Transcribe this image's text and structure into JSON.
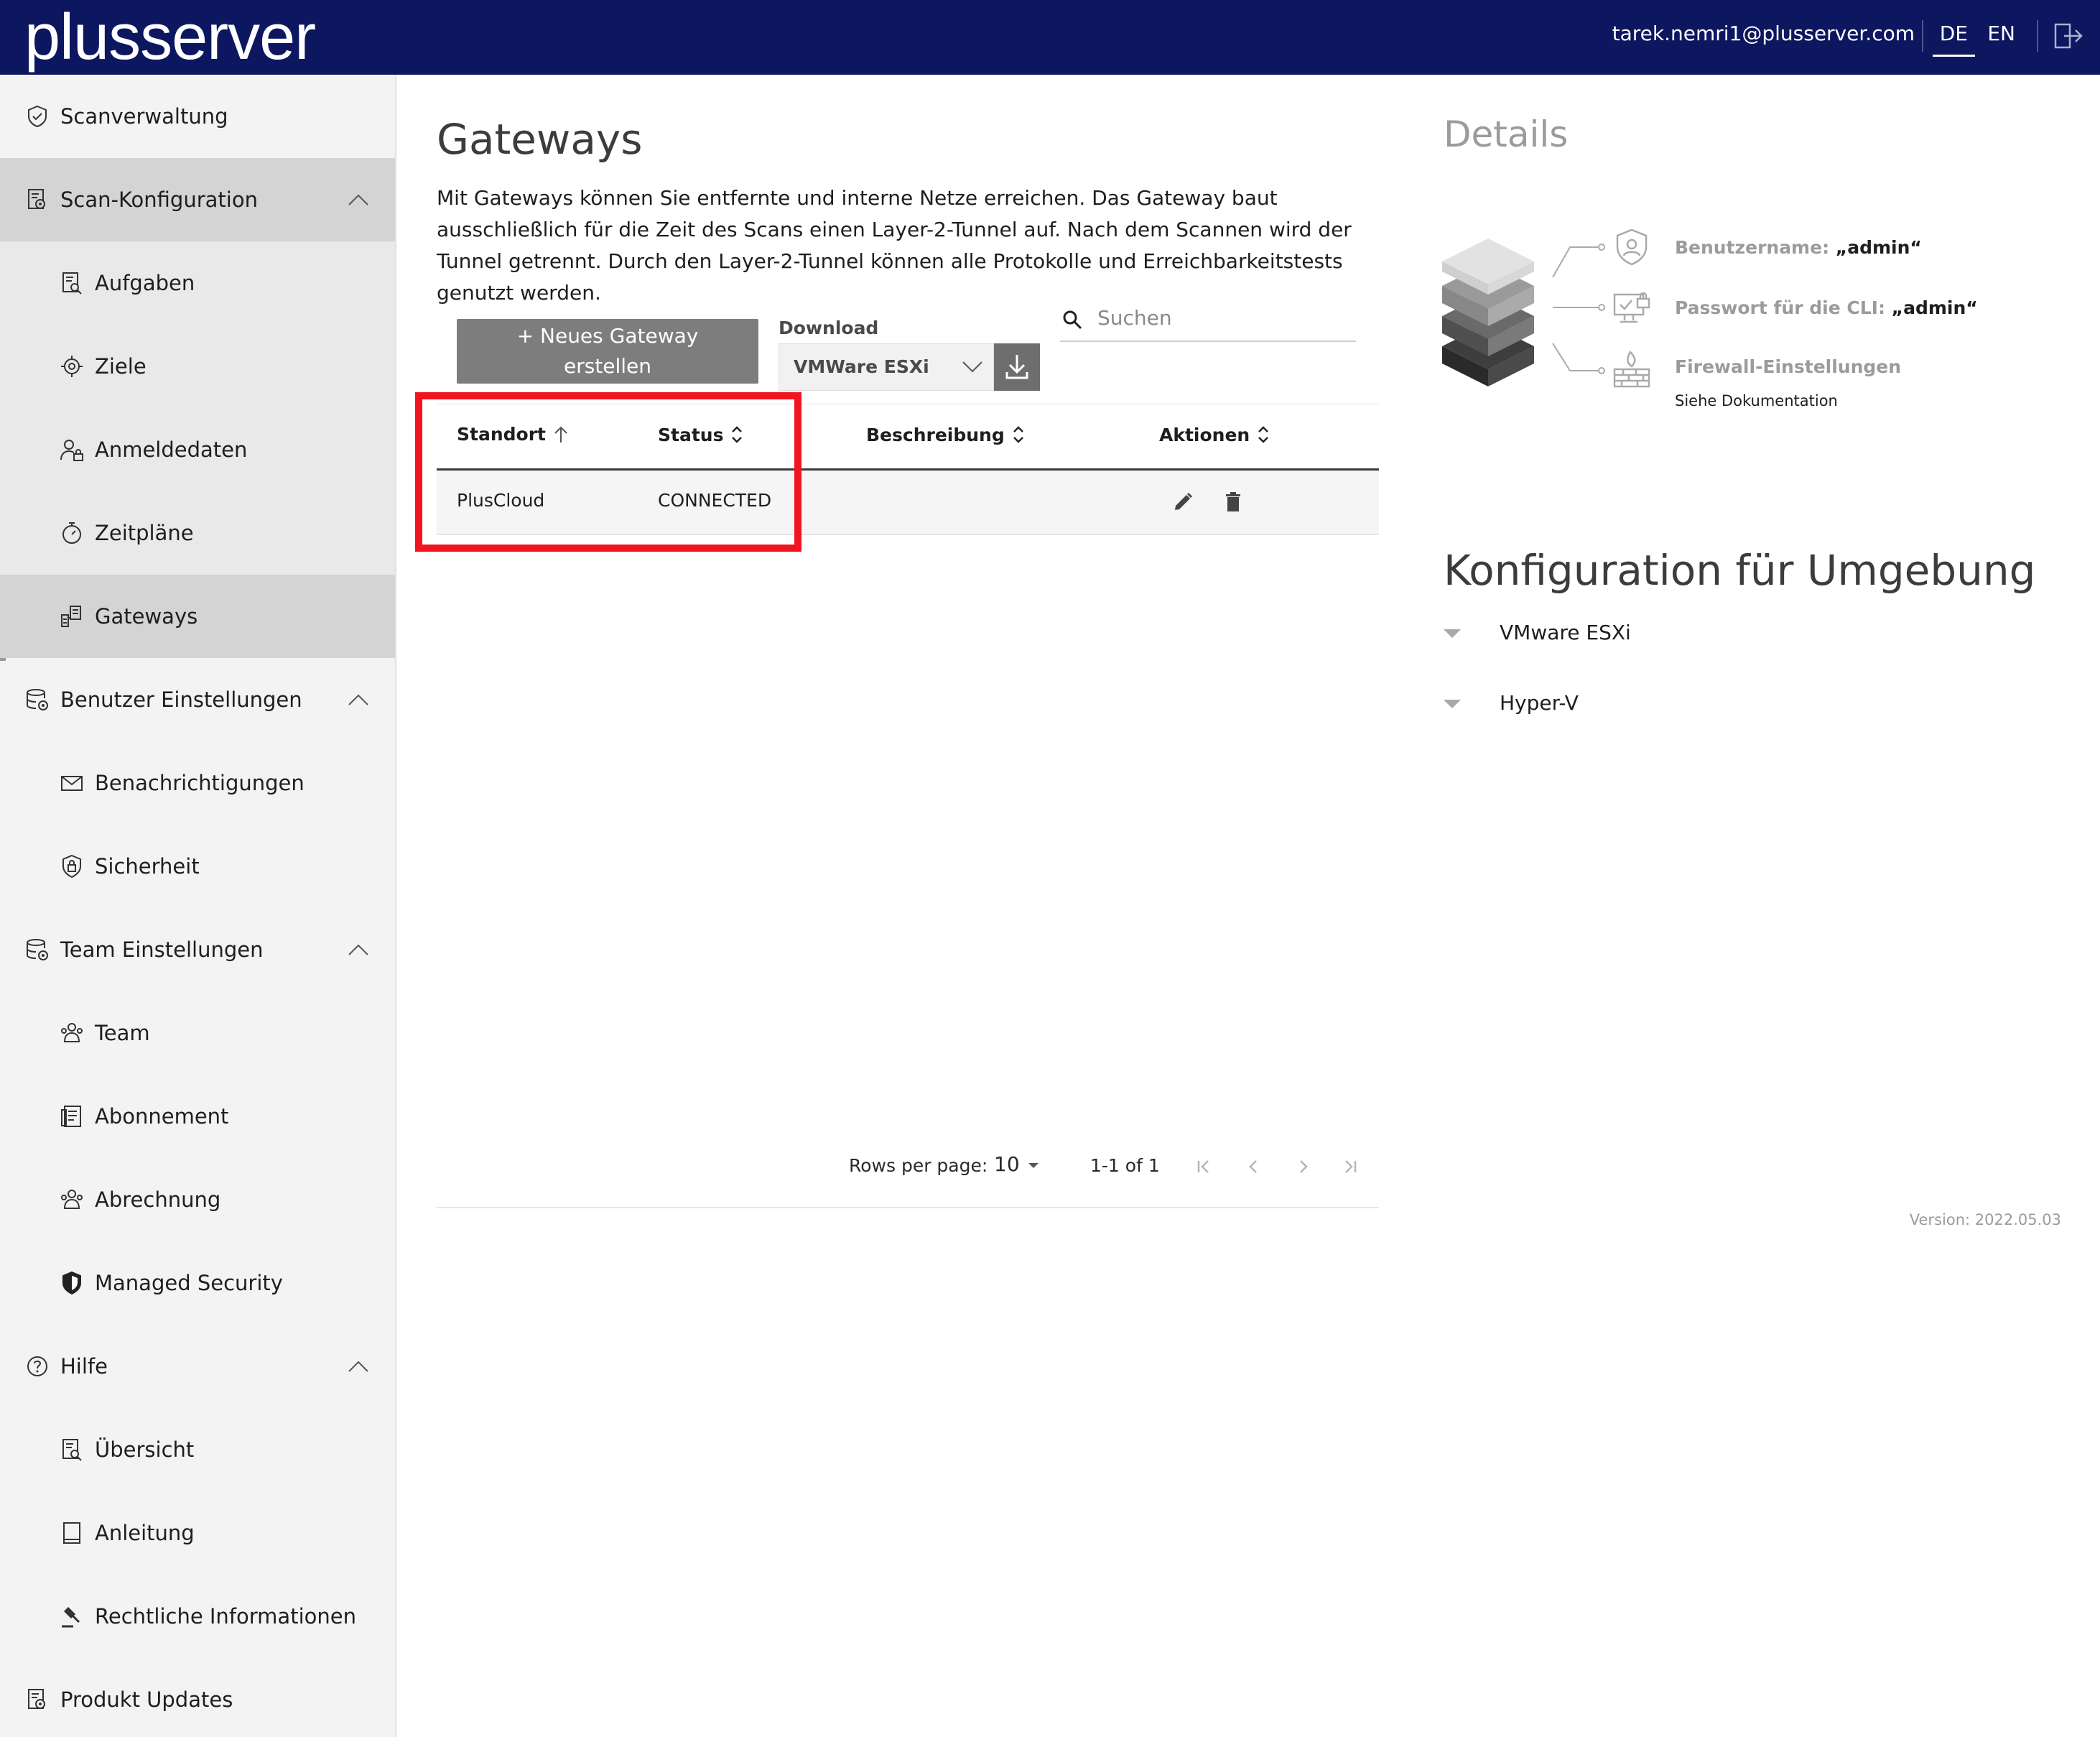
{
  "header": {
    "logo_text": "plusserver",
    "user_email": "tarek.nemri1@plusserver.com",
    "languages": [
      "DE",
      "EN"
    ],
    "active_language": "DE",
    "background_color": "#0d1760"
  },
  "sidebar": {
    "items": [
      {
        "label": "Scanverwaltung",
        "icon": "shield-check-icon",
        "level": "top"
      },
      {
        "label": "Scan-Konfiguration",
        "icon": "settings-document-icon",
        "level": "top",
        "expanded": true
      },
      {
        "label": "Aufgaben",
        "icon": "document-search-icon",
        "level": "sub"
      },
      {
        "label": "Ziele",
        "icon": "target-icon",
        "level": "sub"
      },
      {
        "label": "Anmeldedaten",
        "icon": "user-lock-icon",
        "level": "sub"
      },
      {
        "label": "Zeitpläne",
        "icon": "stopwatch-icon",
        "level": "sub"
      },
      {
        "label": "Gateways",
        "icon": "gateway-icon",
        "level": "sub",
        "selected": true
      },
      {
        "label": "Benutzer Einstellungen",
        "icon": "database-settings-icon",
        "level": "top",
        "expanded": true
      },
      {
        "label": "Benachrichtigungen",
        "icon": "envelope-icon",
        "level": "sub"
      },
      {
        "label": "Sicherheit",
        "icon": "security-lock-icon",
        "level": "sub"
      },
      {
        "label": "Team Einstellungen",
        "icon": "database-settings-icon",
        "level": "top",
        "expanded": true
      },
      {
        "label": "Team",
        "icon": "team-icon",
        "level": "sub"
      },
      {
        "label": "Abonnement",
        "icon": "subscription-icon",
        "level": "sub"
      },
      {
        "label": "Abrechnung",
        "icon": "billing-icon",
        "level": "sub"
      },
      {
        "label": "Managed Security",
        "icon": "shield-icon",
        "level": "sub"
      },
      {
        "label": "Hilfe",
        "icon": "help-circle-icon",
        "level": "top",
        "expanded": true
      },
      {
        "label": "Übersicht",
        "icon": "document-search-icon",
        "level": "sub"
      },
      {
        "label": "Anleitung",
        "icon": "book-icon",
        "level": "sub"
      },
      {
        "label": "Rechtliche Informationen",
        "icon": "gavel-icon",
        "level": "sub"
      },
      {
        "label": "Produkt Updates",
        "icon": "settings-document-icon",
        "level": "top"
      }
    ]
  },
  "main": {
    "title": "Gateways",
    "description": "Mit Gateways können Sie entfernte und interne Netze erreichen. Das Gateway baut ausschließlich für die Zeit des Scans einen Layer-2-Tunnel auf. Nach dem Scannen wird der Tunnel getrennt. Durch den Layer-2-Tunnel können alle Protokolle und Erreichbarkeitstests genutzt werden.",
    "new_button_label": "+ Neues Gateway\nerstellen",
    "download_label": "Download",
    "download_selected": "VMWare ESXi",
    "search_placeholder": "Suchen",
    "table": {
      "columns": [
        "Standort",
        "Status",
        "Beschreibung",
        "Aktionen"
      ],
      "rows": [
        {
          "standort": "PlusCloud",
          "status": "CONNECTED",
          "beschreibung": ""
        }
      ]
    },
    "pagination": {
      "rows_per_page_label": "Rows per page:",
      "rows_per_page": "10",
      "range": "1-1 of 1"
    },
    "highlight_color": "#f0151f"
  },
  "details": {
    "title": "Details",
    "username_label": "Benutzername:",
    "username_value": "„admin“",
    "cli_password_label": "Passwort für die CLI:",
    "cli_password_value": "„admin“",
    "firewall_label": "Firewall-Einstellungen",
    "firewall_sub": "Siehe Dokumentation"
  },
  "config": {
    "title": "Konfiguration für Umgebung",
    "items": [
      "VMware ESXi",
      "Hyper-V"
    ]
  },
  "version": "Version: 2022.05.03"
}
